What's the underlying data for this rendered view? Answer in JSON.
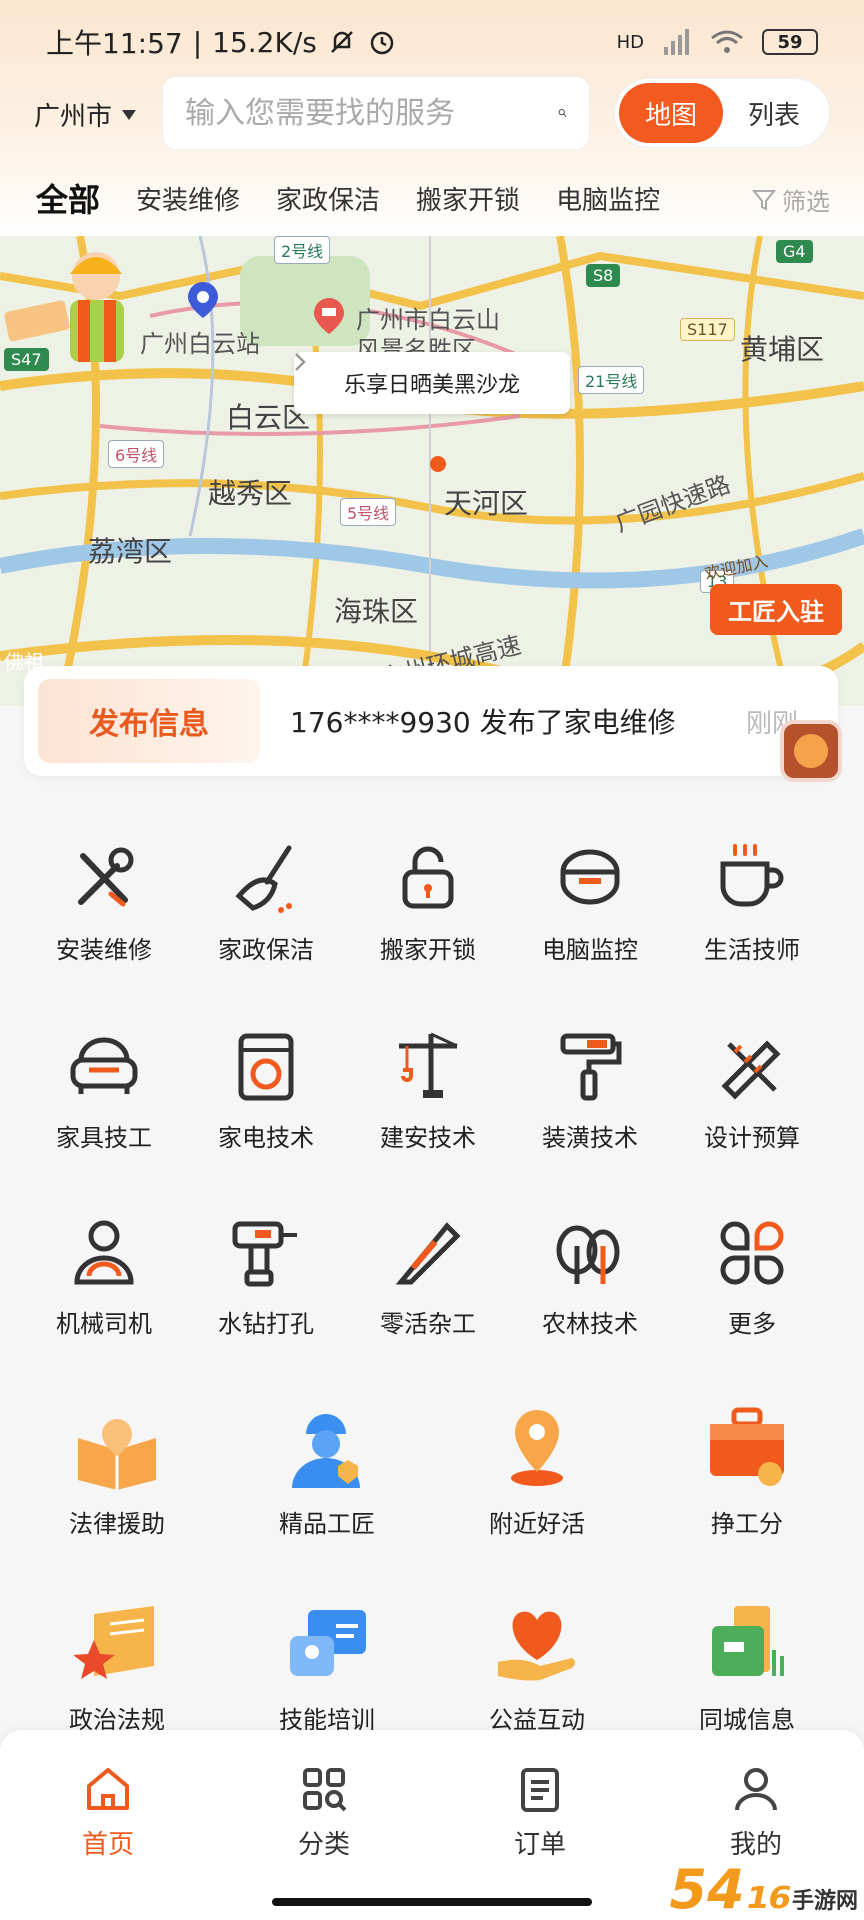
{
  "status": {
    "time": "上午11:57",
    "speed": "15.2K/s",
    "network": "HD",
    "battery": "59"
  },
  "header": {
    "city": "广州市",
    "search_placeholder": "输入您需要找的服务",
    "view_toggle": {
      "map": "地图",
      "list": "列表"
    }
  },
  "category_tabs": [
    "全部",
    "安装维修",
    "家政保洁",
    "搬家开锁",
    "电脑监控"
  ],
  "filter_label": "筛选",
  "map": {
    "callout": "乐享日晒美黑沙龙",
    "labels": [
      "广州白云站",
      "广州市白云山",
      "风景名胜区",
      "白云区",
      "越秀区",
      "天河区",
      "荔湾区",
      "海珠区",
      "黄埔区",
      "广园快速路",
      "广州环城高速",
      "佛祖"
    ],
    "road_badges": [
      "2号线",
      "S8",
      "G4",
      "S47",
      "S117",
      "21号线",
      "6号线",
      "5号线",
      "13"
    ],
    "worker_sign": "欢迎加入",
    "worker_button": "工匠入驻"
  },
  "publish": {
    "tag": "发布信息",
    "text": "176****9930 发布了家电维修",
    "time": "刚刚"
  },
  "services_row1": [
    {
      "label": "安装维修",
      "icon": "wrench-screwdriver-icon"
    },
    {
      "label": "家政保洁",
      "icon": "broom-icon"
    },
    {
      "label": "搬家开锁",
      "icon": "unlock-icon"
    },
    {
      "label": "电脑监控",
      "icon": "monitor-camera-icon"
    },
    {
      "label": "生活技师",
      "icon": "cup-icon"
    }
  ],
  "services_row2": [
    {
      "label": "家具技工",
      "icon": "sofa-icon"
    },
    {
      "label": "家电技术",
      "icon": "washing-machine-icon"
    },
    {
      "label": "建安技术",
      "icon": "crane-icon"
    },
    {
      "label": "装潢技术",
      "icon": "paint-roller-icon"
    },
    {
      "label": "设计预算",
      "icon": "ruler-pencil-icon"
    }
  ],
  "services_row3": [
    {
      "label": "机械司机",
      "icon": "driver-icon"
    },
    {
      "label": "水钻打孔",
      "icon": "drill-icon"
    },
    {
      "label": "零活杂工",
      "icon": "cutter-icon"
    },
    {
      "label": "农林技术",
      "icon": "tree-icon"
    },
    {
      "label": "更多",
      "icon": "more-grid-icon"
    }
  ],
  "features_row1": [
    {
      "label": "法律援助",
      "icon": "law-book-icon"
    },
    {
      "label": "精品工匠",
      "icon": "craftsman-icon"
    },
    {
      "label": "附近好活",
      "icon": "location-pin-icon"
    },
    {
      "label": "挣工分",
      "icon": "toolbox-icon"
    }
  ],
  "features_row2": [
    {
      "label": "政治法规",
      "icon": "policy-book-icon"
    },
    {
      "label": "技能培训",
      "icon": "training-card-icon"
    },
    {
      "label": "公益互动",
      "icon": "heart-hand-icon"
    },
    {
      "label": "同城信息",
      "icon": "city-info-icon"
    }
  ],
  "bottom_nav": [
    {
      "label": "首页",
      "active": true
    },
    {
      "label": "分类",
      "active": false
    },
    {
      "label": "订单",
      "active": false
    },
    {
      "label": "我的",
      "active": false
    }
  ],
  "watermark": {
    "number": "54₁₆",
    "text": "手游网"
  },
  "colors": {
    "accent": "#f05a1c",
    "icon_stroke": "#333333",
    "header_bg": "#fbe6cf"
  }
}
